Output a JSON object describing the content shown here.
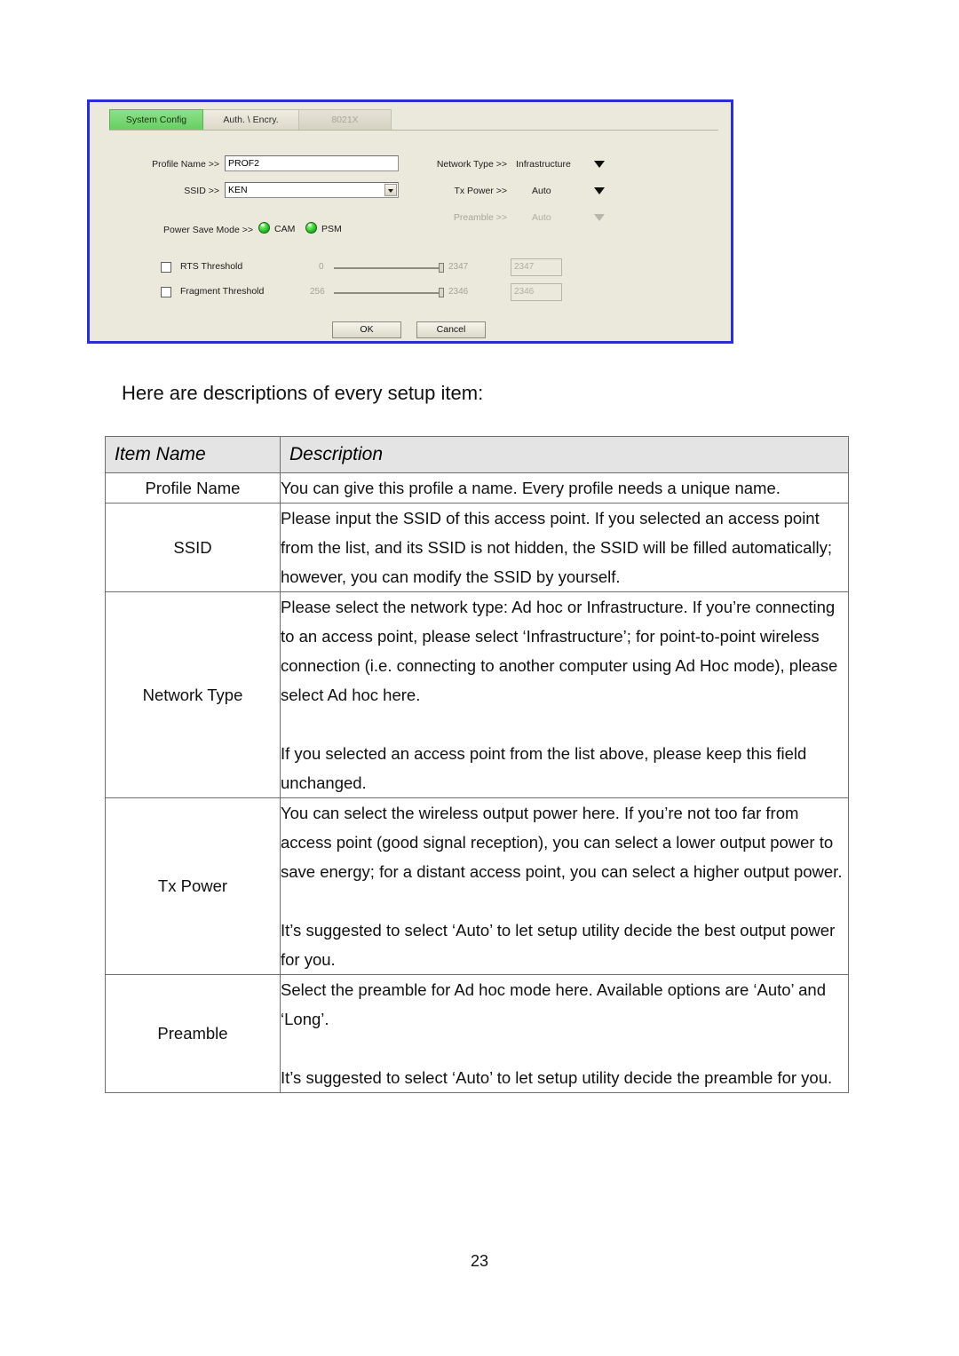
{
  "screenshot": {
    "tabs": [
      {
        "label": "System Config",
        "state": "active"
      },
      {
        "label": "Auth. \\ Encry.",
        "state": "normal"
      },
      {
        "label": "8021X",
        "state": "disabled"
      }
    ],
    "fields": {
      "profile_name_label": "Profile Name >>",
      "profile_name_value": "PROF2",
      "ssid_label": "SSID >>",
      "ssid_value": "KEN",
      "network_type_label": "Network Type >>",
      "network_type_value": "Infrastructure",
      "tx_power_label": "Tx Power >>",
      "tx_power_value": "Auto",
      "preamble_label": "Preamble >>",
      "preamble_value": "Auto",
      "power_save_label": "Power Save Mode >>",
      "power_save_option_1": "CAM",
      "power_save_option_2": "PSM"
    },
    "thresholds": [
      {
        "label": "RTS Threshold",
        "min": "0",
        "max": "2347",
        "value": "2347"
      },
      {
        "label": "Fragment Threshold",
        "min": "256",
        "max": "2346",
        "value": "2346"
      }
    ],
    "buttons": {
      "ok": "OK",
      "cancel": "Cancel"
    },
    "colors": {
      "dialog_border": "#2b2fd0",
      "dialog_background": "#ebe8dc",
      "active_tab": "#66cf62",
      "led_green": "#2fc42c"
    }
  },
  "intro_text": "Here are descriptions of every setup item:",
  "table": {
    "headers": {
      "item": "Item Name",
      "description": "Description"
    },
    "rows": [
      {
        "item": "Profile Name",
        "paragraphs": [
          "You can give this profile a name. Every profile needs a unique name."
        ]
      },
      {
        "item": "SSID",
        "paragraphs": [
          "Please input the SSID of this access point. If you selected an access point from the list, and its SSID is not hidden, the SSID will be filled automatically; however, you can modify the SSID by yourself."
        ]
      },
      {
        "item": "Network Type",
        "paragraphs": [
          "Please select the network type: Ad hoc or Infrastructure. If you’re connecting to an access point, please select ‘Infrastructure’; for point-to-point wireless connection (i.e. connecting to another computer using Ad Hoc mode), please select Ad hoc here.",
          "If you selected an access point from the list above, please keep this field unchanged."
        ]
      },
      {
        "item": "Tx Power",
        "paragraphs": [
          "You can select the wireless output power here. If you’re not too far from access point (good signal reception), you can select a lower output power to save energy; for a distant access point, you can select a higher output power.",
          "It’s suggested to select ‘Auto’ to let setup utility decide the best output power for you."
        ]
      },
      {
        "item": "Preamble",
        "paragraphs": [
          "Select the preamble for Ad hoc mode here. Available options are ‘Auto’ and ‘Long’.",
          "It’s suggested to select ‘Auto’ to let setup utility decide the preamble for you."
        ]
      }
    ]
  },
  "page_number": "23"
}
